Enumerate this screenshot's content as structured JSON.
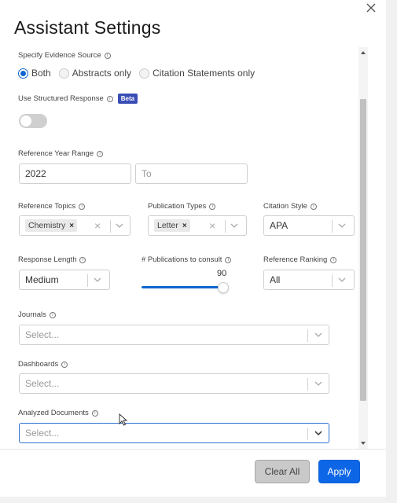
{
  "dialog": {
    "title": "Assistant Settings"
  },
  "evidence_source": {
    "label": "Specify Evidence Source",
    "options": [
      "Both",
      "Abstracts only",
      "Citation Statements only"
    ],
    "selected": "Both"
  },
  "structured_response": {
    "label": "Use Structured Response",
    "badge": "Beta",
    "enabled": false
  },
  "year_range": {
    "label": "Reference Year Range",
    "from_value": "2022",
    "to_placeholder": "To"
  },
  "reference_topics": {
    "label": "Reference Topics",
    "tags": [
      "Chemistry"
    ]
  },
  "publication_types": {
    "label": "Publication Types",
    "tags": [
      "Letter"
    ]
  },
  "citation_style": {
    "label": "Citation Style",
    "value": "APA"
  },
  "response_length": {
    "label": "Response Length",
    "value": "Medium"
  },
  "publications_to_consult": {
    "label": "# Publications to consult",
    "value": "90"
  },
  "reference_ranking": {
    "label": "Reference Ranking",
    "value": "All"
  },
  "journals": {
    "label": "Journals",
    "placeholder": "Select..."
  },
  "dashboards": {
    "label": "Dashboards",
    "placeholder": "Select..."
  },
  "analyzed_documents": {
    "label": "Analyzed Documents",
    "placeholder": "Select..."
  },
  "footer": {
    "clear_label": "Clear All",
    "apply_label": "Apply"
  },
  "icons": {
    "close": "close-icon",
    "info": "info-icon",
    "chevron": "chevron-down-icon",
    "clear": "clear-icon"
  },
  "colors": {
    "accent": "#0d66e6",
    "badge": "#3a4db5"
  }
}
